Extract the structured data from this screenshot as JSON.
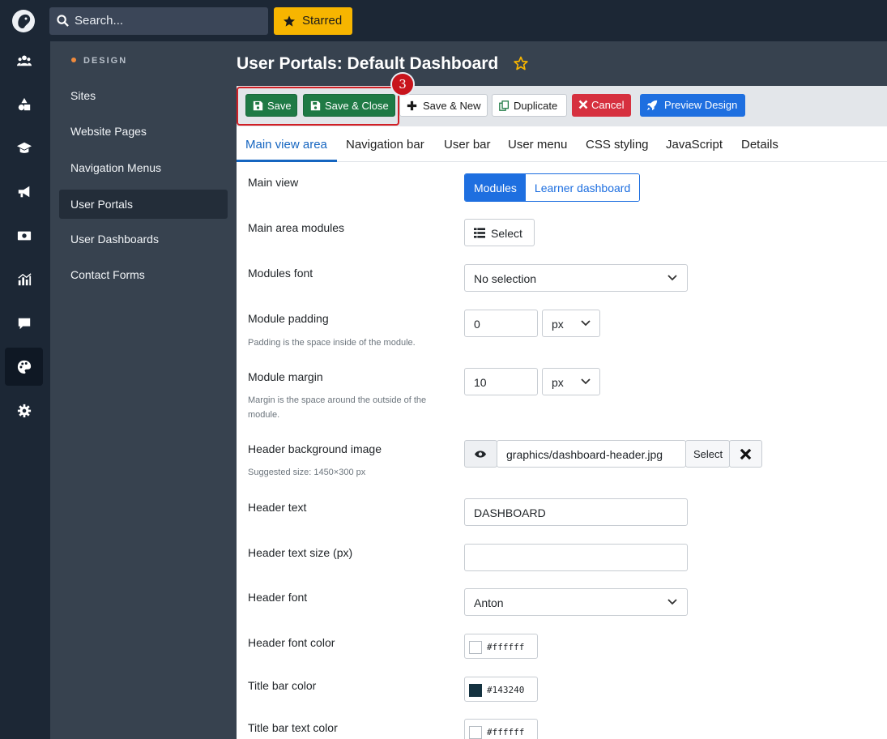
{
  "topbar": {
    "search_placeholder": "Search...",
    "starred_label": "Starred"
  },
  "rail": {
    "icons": [
      "users-icon",
      "shapes-icon",
      "graduation-cap-icon",
      "megaphone-icon",
      "money-bill-icon",
      "chart-icon",
      "comment-icon",
      "palette-icon",
      "gear-icon"
    ],
    "active": "palette-icon"
  },
  "sidebar": {
    "heading": "DESIGN",
    "items": [
      {
        "label": "Sites"
      },
      {
        "label": "Website Pages"
      },
      {
        "label": "Navigation Menus"
      },
      {
        "label": "User Portals",
        "active": true
      },
      {
        "label": "User Dashboards"
      },
      {
        "label": "Contact Forms"
      }
    ]
  },
  "page": {
    "title": "User Portals: Default Dashboard"
  },
  "toolbar": {
    "save": "Save",
    "save_close": "Save & Close",
    "save_new": "Save & New",
    "duplicate": "Duplicate",
    "cancel": "Cancel",
    "preview": "Preview Design",
    "step_badge": "3"
  },
  "tabs": [
    "Main view area",
    "Navigation bar",
    "User bar",
    "User menu",
    "CSS styling",
    "JavaScript",
    "Details"
  ],
  "form": {
    "main_view": {
      "label": "Main view",
      "options": [
        "Modules",
        "Learner dashboard"
      ],
      "selected": "Modules"
    },
    "main_area_modules": {
      "label": "Main area modules",
      "button": "Select"
    },
    "modules_font": {
      "label": "Modules font",
      "value": "No selection"
    },
    "module_padding": {
      "label": "Module padding",
      "help": "Padding is the space inside of the module.",
      "value": "0",
      "unit": "px"
    },
    "module_margin": {
      "label": "Module margin",
      "help": "Margin is the space around the outside of the module.",
      "value": "10",
      "unit": "px"
    },
    "header_bg_image": {
      "label": "Header background image",
      "help": "Suggested size: 1450×300 px",
      "value": "graphics/dashboard-header.jpg",
      "select": "Select"
    },
    "header_text": {
      "label": "Header text",
      "value": "DASHBOARD"
    },
    "header_text_size": {
      "label": "Header text size (px)",
      "value": ""
    },
    "header_font": {
      "label": "Header font",
      "value": "Anton"
    },
    "header_font_color": {
      "label": "Header font color",
      "value": "#ffffff"
    },
    "title_bar_color": {
      "label": "Title bar color",
      "value": "#143240"
    },
    "title_bar_text_color": {
      "label": "Title bar text color",
      "value": "#ffffff"
    }
  }
}
